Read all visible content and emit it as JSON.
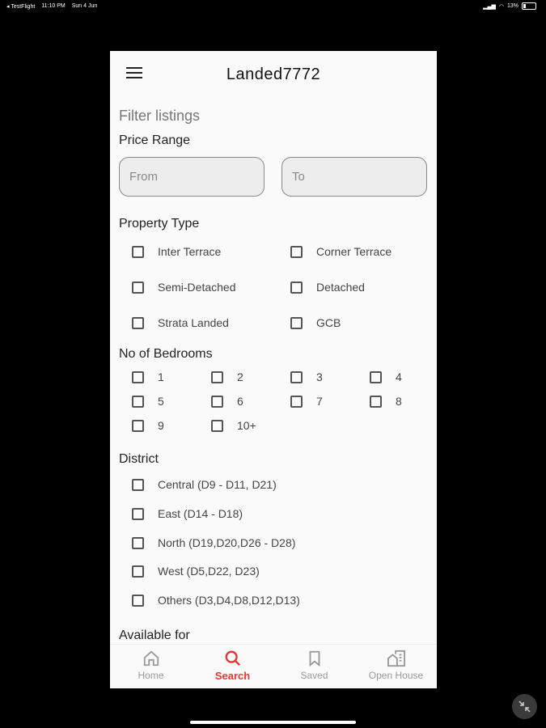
{
  "status_bar": {
    "carrier": "◂ TestFlight",
    "time": "11:10 PM",
    "date": "Sun 4 Jun",
    "battery": "13%"
  },
  "app": {
    "title": "Landed7772"
  },
  "filter": {
    "heading": "Filter listings",
    "price_range": {
      "title": "Price Range",
      "from_placeholder": "From",
      "to_placeholder": "To"
    },
    "property_type": {
      "title": "Property Type",
      "options": [
        "Inter Terrace",
        "Corner Terrace",
        "Semi-Detached",
        "Detached",
        "Strata Landed",
        "GCB"
      ]
    },
    "bedrooms": {
      "title": "No of Bedrooms",
      "options": [
        "1",
        "2",
        "3",
        "4",
        "5",
        "6",
        "7",
        "8",
        "9",
        "10+"
      ]
    },
    "district": {
      "title": "District",
      "options": [
        "Central (D9 - D11, D21)",
        "East (D14 - D18)",
        "North (D19,D20,D26 - D28)",
        "West (D5,D22, D23)",
        "Others (D3,D4,D8,D12,D13)"
      ]
    },
    "available_for": {
      "title": "Available for"
    }
  },
  "bottom_nav": {
    "items": [
      {
        "label": "Home",
        "icon": "home-icon",
        "active": false
      },
      {
        "label": "Search",
        "icon": "search-icon",
        "active": true
      },
      {
        "label": "Saved",
        "icon": "bookmark-icon",
        "active": false
      },
      {
        "label": "Open House",
        "icon": "open-house-icon",
        "active": false
      }
    ]
  },
  "colors": {
    "accent": "#e53935",
    "background": "#fafafa",
    "frame": "#000000"
  }
}
